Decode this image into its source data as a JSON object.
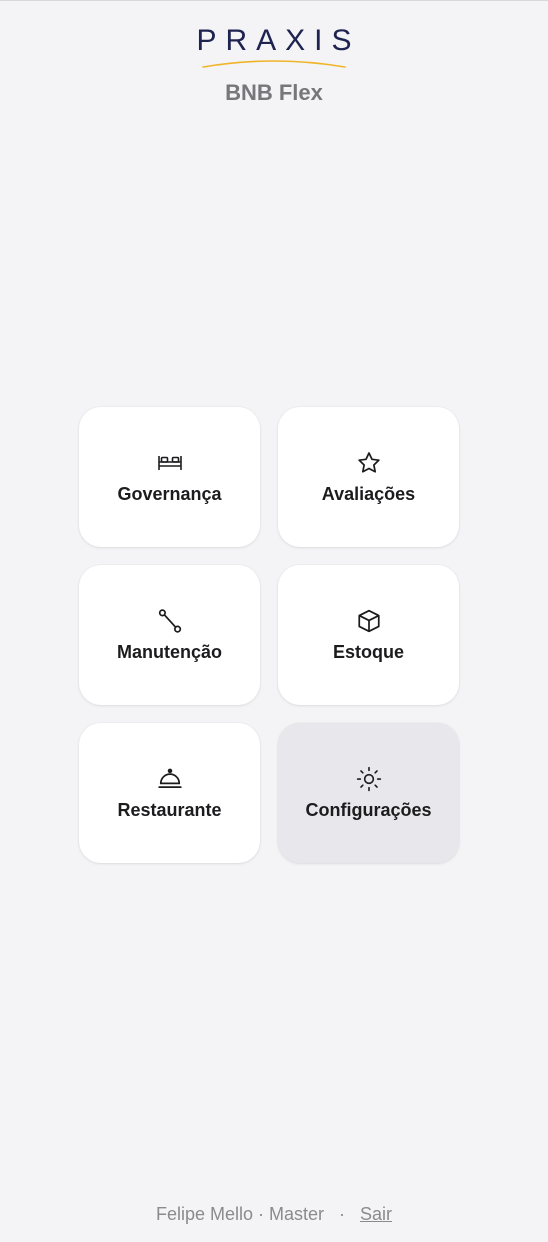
{
  "brand": {
    "logo_text": "PRAXIS",
    "app_title": "BNB Flex",
    "colors": {
      "logo_navy": "#1e2350",
      "logo_accent": "#f0b429",
      "tile_bg": "#ffffff",
      "tile_active_bg": "#e8e7ec",
      "page_bg": "#f4f4f6"
    }
  },
  "menu": {
    "items": [
      {
        "label": "Governança",
        "icon": "bed-icon"
      },
      {
        "label": "Avaliações",
        "icon": "star-icon"
      },
      {
        "label": "Manutenção",
        "icon": "route-icon"
      },
      {
        "label": "Estoque",
        "icon": "box-icon"
      },
      {
        "label": "Restaurante",
        "icon": "cloche-icon"
      },
      {
        "label": "Configurações",
        "icon": "sun-icon",
        "active": true
      }
    ]
  },
  "footer": {
    "user_info": "Felipe Mello · Master",
    "separator": "·",
    "logout_label": "Sair"
  }
}
